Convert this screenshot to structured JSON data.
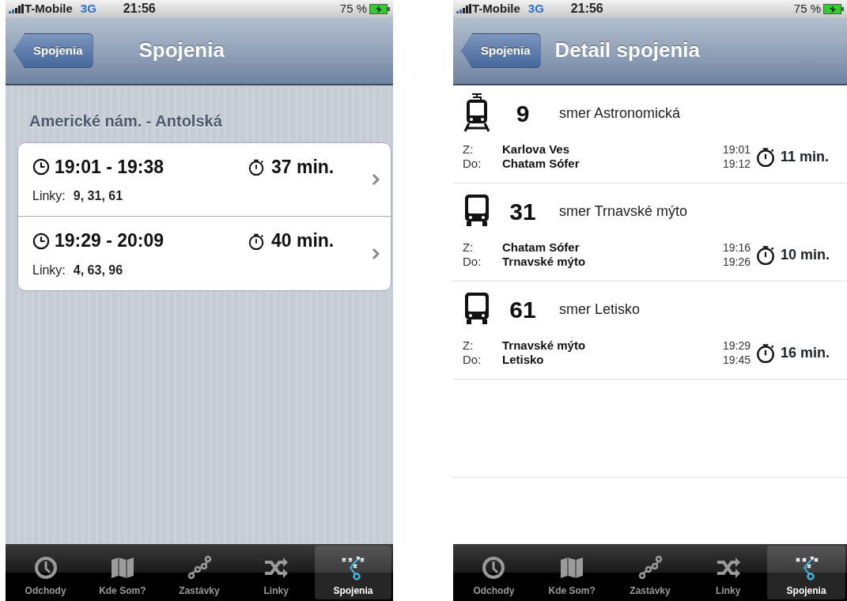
{
  "screens": [
    {
      "kind": "list",
      "status_bar": {
        "carrier": "T-Mobile",
        "network": "3G",
        "time": "21:56",
        "battery": "75 %"
      },
      "nav": {
        "back": "Spojenia",
        "title": "Spojenia"
      },
      "section_title": "Americké nám. - Antolská",
      "connections": [
        {
          "time": "19:01 - 19:38",
          "duration": "37 min.",
          "lines_label": "Linky:",
          "lines": "9, 31, 61"
        },
        {
          "time": "19:29 - 20:09",
          "duration": "40 min.",
          "lines_label": "Linky:",
          "lines": "4, 63, 96"
        }
      ],
      "tab_bar": [
        {
          "kind": "clock",
          "label": "Odchody",
          "selected": false
        },
        {
          "kind": "map",
          "label": "Kde Som?",
          "selected": false
        },
        {
          "kind": "stops",
          "label": "Zastávky",
          "selected": false
        },
        {
          "kind": "shuffle",
          "label": "Linky",
          "selected": false
        },
        {
          "kind": "route",
          "label": "Spojenia",
          "selected": true
        }
      ]
    },
    {
      "kind": "detail",
      "status_bar": {
        "carrier": "T-Mobile",
        "network": "3G",
        "time": "21:56",
        "battery": "75 %"
      },
      "nav": {
        "back": "Spojenia",
        "title": "Detail spojenia"
      },
      "legs": [
        {
          "kind": "tram",
          "line": "9",
          "direction": "smer Astronomická",
          "from_label": "Z:",
          "from": "Karlova Ves",
          "to_label": "Do:",
          "to": "Chatam Sófer",
          "departure": "19:01",
          "arrival": "19:12",
          "duration": "11 min."
        },
        {
          "kind": "bus",
          "line": "31",
          "direction": "smer Trnavské mýto",
          "from_label": "Z:",
          "from": "Chatam Sófer",
          "to_label": "Do:",
          "to": "Trnavské mýto",
          "departure": "19:16",
          "arrival": "19:26",
          "duration": "10 min."
        },
        {
          "kind": "bus",
          "line": "61",
          "direction": "smer Letisko",
          "from_label": "Z:",
          "from": "Trnavské mýto",
          "to_label": "Do:",
          "to": "Letisko",
          "departure": "19:29",
          "arrival": "19:45",
          "duration": "16 min."
        }
      ],
      "tab_bar": [
        {
          "kind": "clock",
          "label": "Odchody",
          "selected": false
        },
        {
          "kind": "map",
          "label": "Kde Som?",
          "selected": false
        },
        {
          "kind": "stops",
          "label": "Zastávky",
          "selected": false
        },
        {
          "kind": "shuffle",
          "label": "Linky",
          "selected": false
        },
        {
          "kind": "route",
          "label": "Spojenia",
          "selected": true
        }
      ]
    }
  ]
}
